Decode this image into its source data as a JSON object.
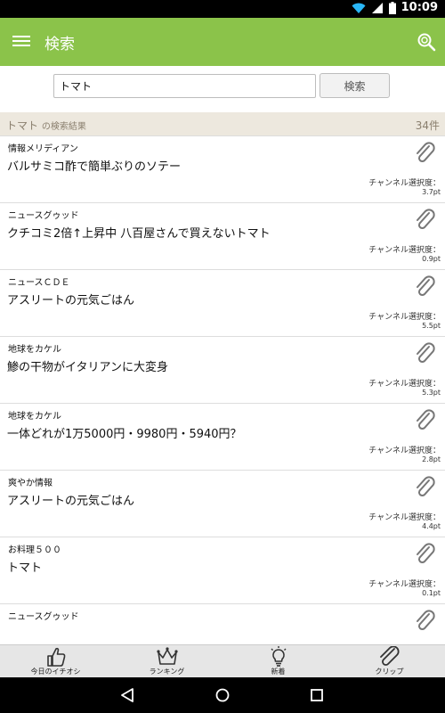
{
  "status_bar": {
    "time": "10:09",
    "icons": [
      "wifi-icon",
      "cellular-signal-icon",
      "battery-icon"
    ]
  },
  "app_bar": {
    "title": "検索",
    "icons": [
      "menu-icon",
      "search-icon"
    ],
    "color": "#8bc34a"
  },
  "search": {
    "value": "トマト",
    "button_label": "検索"
  },
  "results_header": {
    "keyword": "トマト",
    "suffix": "の検索結果",
    "count": "34件"
  },
  "results": [
    {
      "channel": "情報メリディアン",
      "title": "バルサミコ酢で簡単ぶりのソテー",
      "degree_label": "チャンネル選択度：",
      "degree_value": "3.7pt"
    },
    {
      "channel": "ニュースグゥッド",
      "title": "クチコミ2倍↑上昇中 八百屋さんで買えないトマト",
      "degree_label": "チャンネル選択度：",
      "degree_value": "0.9pt"
    },
    {
      "channel": "ニュースＣＤＥ",
      "title": "アスリートの元気ごはん",
      "degree_label": "チャンネル選択度：",
      "degree_value": "5.5pt"
    },
    {
      "channel": "地球をカケル",
      "title": "鯵の干物がイタリアンに大変身",
      "degree_label": "チャンネル選択度：",
      "degree_value": "5.3pt"
    },
    {
      "channel": "地球をカケル",
      "title": "一体どれが1万5000円・9980円・5940円？",
      "degree_label": "チャンネル選択度：",
      "degree_value": "2.8pt"
    },
    {
      "channel": "爽やか情報",
      "title": "アスリートの元気ごはん",
      "degree_label": "チャンネル選択度：",
      "degree_value": "4.4pt"
    },
    {
      "channel": "お料理５００",
      "title": "トマト",
      "degree_label": "チャンネル選択度：",
      "degree_value": "0.1pt"
    },
    {
      "channel": "ニュースグゥッド",
      "title": "",
      "degree_label": "",
      "degree_value": ""
    }
  ],
  "bottom_nav": [
    {
      "label": "今日のイチオシ",
      "icon": "thumbs-up-icon"
    },
    {
      "label": "ランキング",
      "icon": "crown-icon"
    },
    {
      "label": "新着",
      "icon": "lightbulb-icon"
    },
    {
      "label": "クリップ",
      "icon": "paperclip-icon"
    }
  ],
  "system_nav": [
    "back-icon",
    "home-icon",
    "recents-icon"
  ]
}
